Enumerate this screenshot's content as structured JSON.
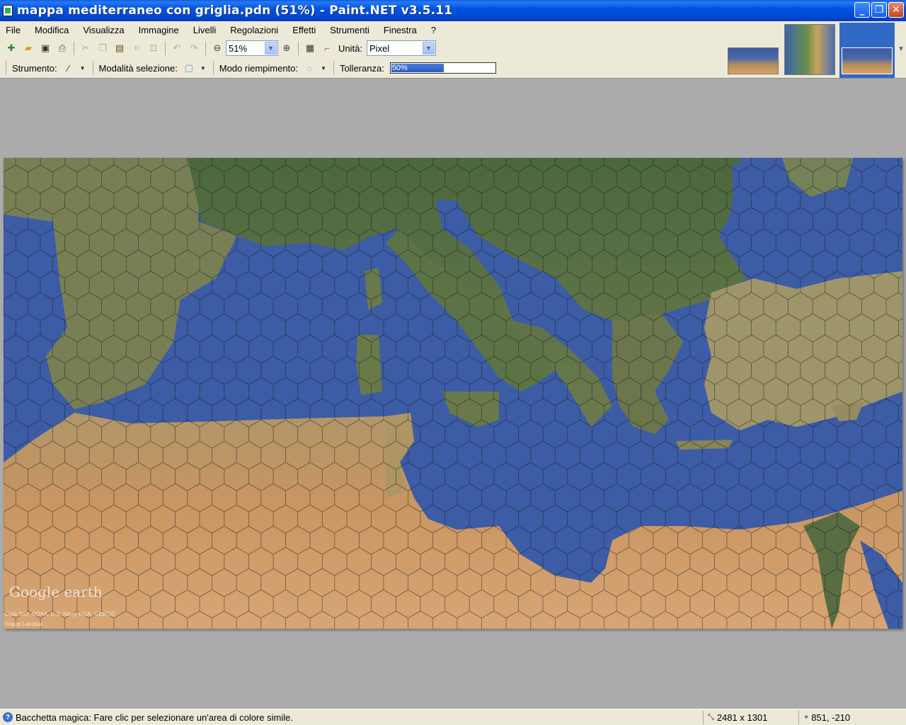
{
  "window": {
    "title": "mappa mediterraneo con griglia.pdn (51%) - Paint.NET v3.5.11",
    "buttons": {
      "minimize": "_",
      "maximize": "❐",
      "close": "✕"
    }
  },
  "menu": {
    "items": [
      "File",
      "Modifica",
      "Visualizza",
      "Immagine",
      "Livelli",
      "Regolazioni",
      "Effetti",
      "Strumenti",
      "Finestra",
      "?"
    ]
  },
  "toolbar": {
    "zoom_value": "51%",
    "units_label": "Unità:",
    "units_value": "Pixel",
    "icons": [
      "new-file-icon",
      "open-file-icon",
      "save-icon",
      "print-icon",
      "cut-icon",
      "copy-icon",
      "paste-icon",
      "crop-icon",
      "deselect-icon",
      "undo-icon",
      "redo-icon",
      "zoom-out-icon",
      "zoom-in-icon",
      "grid-icon",
      "rulers-icon"
    ]
  },
  "tool_options": {
    "tool_label": "Strumento:",
    "selection_mode_label": "Modalità selezione:",
    "fill_mode_label": "Modo riempimento:",
    "tolerance_label": "Tolleranza:",
    "tolerance_value": "50%",
    "tolerance_fraction": 0.5
  },
  "canvas": {
    "watermark_logo": "Google earth",
    "credit_line1": "Data SIO, NOAA, U.S. Navy, NGA, GEBCO",
    "credit_line2": "Image Landsat",
    "colors": {
      "sea": "#3e5ea8",
      "land_green": "#5f7a45",
      "desert": "#d39a60",
      "grid": "#1a1a1a"
    }
  },
  "status": {
    "message": "Bacchetta magica: Fare clic per selezionare un'area di colore simile.",
    "image_size": "2481 x 1301",
    "cursor_position": "851, -210"
  }
}
